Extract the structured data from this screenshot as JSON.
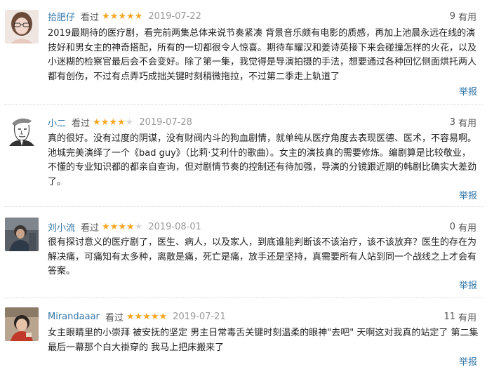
{
  "reviews": [
    {
      "author": "拾肥仔",
      "watched": "看过",
      "rating": 5,
      "stars_text": "★★★★★",
      "date": "2019-07-22",
      "votes": "9",
      "votes_unit": "有用",
      "lines": [
        "2019最期待的医疗剧，看完前两集总体来说节奏紧凑 背景音乐颇有电影的质感，再加上池晨永远在线的演",
        "技好和男女主的神奇搭配，所有的一切都很令人惊喜。期待车耀汉和姜诗英接下来会碰撞怎样的火花，以及",
        "小迷糊的检察官最后会不会变好。除了第一集，我觉得是导演拍摄的手法，想要通过各种回忆侧面烘托两人",
        "都有创伤，不过有点弄巧成拙关键时刻稍微拖拉，不过第二季走上轨道了"
      ],
      "report": "举报",
      "avatar_icon": "avatar-photo-girl"
    },
    {
      "author": "小二",
      "watched": "看过",
      "rating": 4,
      "stars_text": "★★★★☆",
      "date": "2019-07-28",
      "votes": "3",
      "votes_unit": "有用",
      "lines": [
        "真的很好。没有过度的阴谋，没有财阀内斗的狗血剧情，就单纯从医疗角度去表现医德、医术，不容易啊。",
        "池城完美演绎了一个《bad guy》（比莉·艾利什的歌曲）。女主的演技真的需要修炼。编剧算是比较敬业，",
        "不懂的专业知识都的都亲自查询，但对剧情节奏的控制还有待加强，导演的分镜跟近期的韩剧比确实大差劲",
        "了。"
      ],
      "report": "举报",
      "avatar_icon": "avatar-sketch-portrait"
    },
    {
      "author": "刘小流",
      "watched": "看过",
      "rating": 4,
      "stars_text": "★★★★☆",
      "date": "2019-08-01",
      "votes": "0",
      "votes_unit": "有用",
      "lines": [
        "很有探讨意义的医疗剧了，医生、病人，以及家人，到底谁能判断该不该治疗，该不该放弃？医生的存在为",
        "解决痛，可痛知有太多种，离散是痛，死亡是痛，放手还是坚持，真需要所有人站到同一个战线之上才会有",
        "答案。"
      ],
      "report": "举报",
      "avatar_icon": "avatar-photo-person"
    },
    {
      "author": "Mirandaaar",
      "watched": "看过",
      "rating": 5,
      "stars_text": "★★★★★",
      "date": "2019-07-21",
      "votes": "11",
      "votes_unit": "有用",
      "lines": [
        "女主眼睛里的小崇拜 被安抚的坚定 男主日常毒舌关键时刻温柔的眼神\"去吧\" 天啊这对我真的站定了 第二集",
        "最后一幕那个白大褂穿的 我马上把床搬来了"
      ],
      "report": "举报",
      "avatar_icon": "avatar-photo-child"
    }
  ],
  "colors": {
    "link": "#3377aa",
    "star": "#f5a623",
    "date": "#999999",
    "text": "#222222"
  }
}
